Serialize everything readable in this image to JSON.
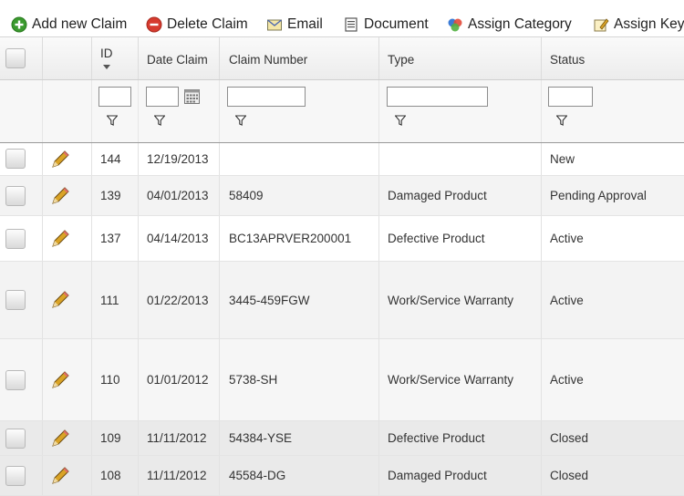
{
  "toolbar": {
    "add_label": "Add new Claim",
    "delete_label": "Delete Claim",
    "email_label": "Email",
    "document_label": "Document",
    "assign_category_label": "Assign Category",
    "assign_keyword_label": "Assign Keyw"
  },
  "columns": {
    "id": "ID",
    "date": "Date Claim",
    "number": "Claim Number",
    "type": "Type",
    "status": "Status"
  },
  "filters": {
    "id": "",
    "date": "",
    "number": "",
    "type": "",
    "status": ""
  },
  "rows": [
    {
      "id": "144",
      "date": "12/19/2013",
      "number": "",
      "type": "",
      "status": "New"
    },
    {
      "id": "139",
      "date": "04/01/2013",
      "number": "58409",
      "type": "Damaged Product",
      "status": "Pending Approval"
    },
    {
      "id": "137",
      "date": "04/14/2013",
      "number": "BC13APRVER200001",
      "type": "Defective Product",
      "status": "Active"
    },
    {
      "id": "111",
      "date": "01/22/2013",
      "number": "3445-459FGW",
      "type": "Work/Service Warranty",
      "status": "Active"
    },
    {
      "id": "110",
      "date": "01/01/2012",
      "number": "5738-SH",
      "type": "Work/Service Warranty",
      "status": "Active"
    },
    {
      "id": "109",
      "date": "11/11/2012",
      "number": "54384-YSE",
      "type": "Defective Product",
      "status": "Closed"
    },
    {
      "id": "108",
      "date": "11/11/2012",
      "number": "45584-DG",
      "type": "Damaged Product",
      "status": "Closed"
    }
  ],
  "colors": {
    "add_icon": "#3a9a2e",
    "delete_icon": "#d63a2e",
    "pencil": "#d9a326"
  }
}
